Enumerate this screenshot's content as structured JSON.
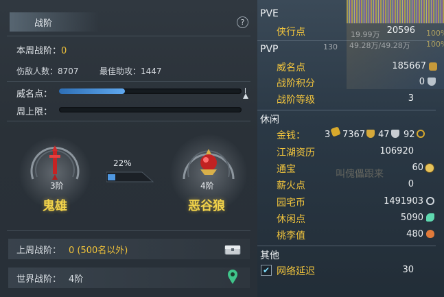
{
  "left_panel": {
    "title": "战阶",
    "help": "?",
    "weekly_rank_label": "本周战阶：",
    "weekly_rank_value": "0",
    "kills_label": "伤敌人数：",
    "kills_value": "8707",
    "best_assist_label": "最佳助攻：",
    "best_assist_value": "1447",
    "prestige_label": "威名点：",
    "prestige_progress": 0.36,
    "weekly_cap_label": "周上限：",
    "weekly_cap_progress": 0.0,
    "current_rank": {
      "level": "3阶",
      "name": "鬼雄"
    },
    "progress_percent_text": "22%",
    "progress_fraction": 0.22,
    "next_rank": {
      "level": "4阶",
      "name": "恶谷狼"
    },
    "last_week_label": "上周战阶：",
    "last_week_value": "0 (500名以外)",
    "world_rank_label": "世界战阶：",
    "world_rank_value": "4阶"
  },
  "right_panel": {
    "pve": {
      "header": "PVE",
      "rows": [
        {
          "label": "侠行点",
          "value": "20596"
        }
      ]
    },
    "pvp": {
      "header": "PVP",
      "rows": [
        {
          "label": "威名点",
          "value": "185667"
        },
        {
          "label": "战阶积分",
          "value": "0"
        },
        {
          "label": "战阶等级",
          "value": "3"
        }
      ]
    },
    "leisure": {
      "header": "休闲",
      "money_label": "金钱：",
      "money": {
        "gold": "3",
        "silver": "7367",
        "copper_a": "47",
        "copper_b": "92"
      },
      "rows": [
        {
          "label": "江湖资历",
          "value": "106920"
        },
        {
          "label": "通宝",
          "value": "60"
        },
        {
          "label": "薪火点",
          "value": "0"
        },
        {
          "label": "园宅币",
          "value": "1491903"
        },
        {
          "label": "休闲点",
          "value": "5090"
        },
        {
          "label": "桃李值",
          "value": "480"
        }
      ]
    },
    "other": {
      "header": "其他",
      "network_label": "网络延迟",
      "network_value": "30",
      "network_checked": true
    },
    "background_text": {
      "hp_a": "19.99万",
      "hp_b": "49.28万/49.28万",
      "lvl": "130",
      "pct_a": "100%",
      "pct_b": "100%",
      "ghost": "叫傀儡跟来"
    }
  },
  "colors": {
    "accent_gold": "#f1c43d",
    "progress_blue": "#4f97e0",
    "panel_left": "#2c343b",
    "panel_right": "#2b3946"
  }
}
